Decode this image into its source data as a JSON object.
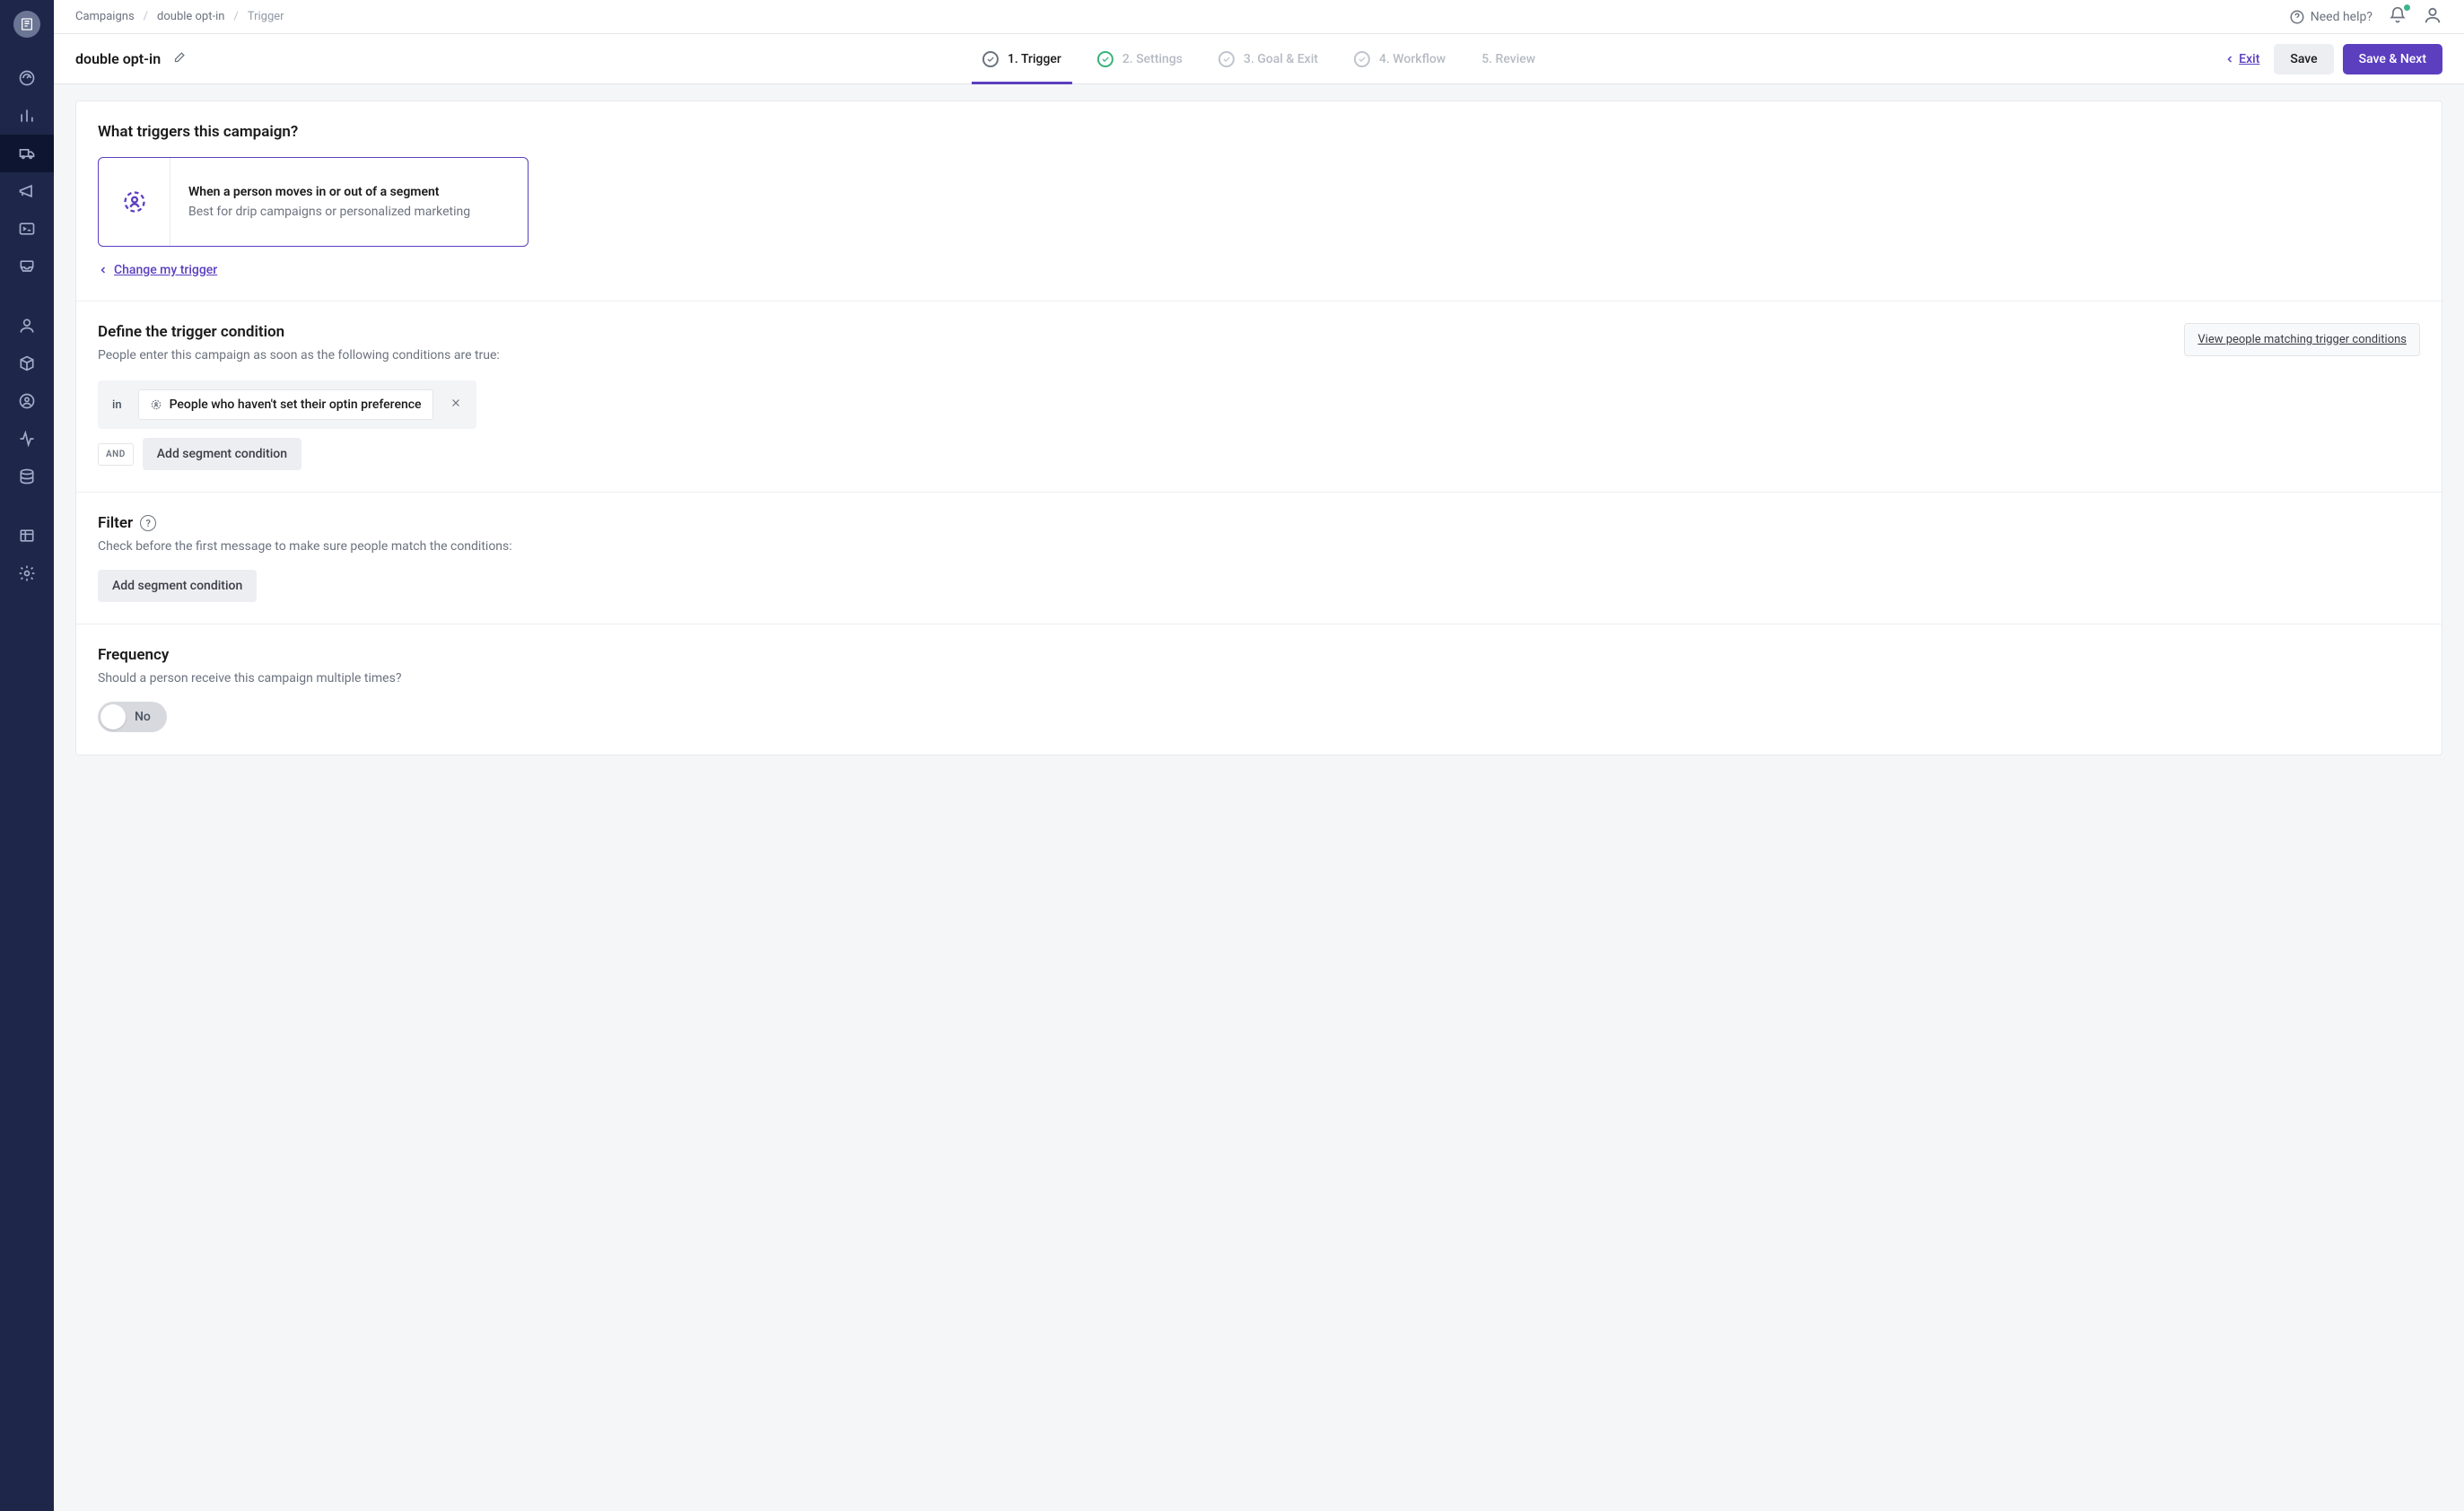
{
  "sidebar": {
    "items": [
      {
        "name": "logo"
      },
      {
        "name": "dashboard-icon"
      },
      {
        "name": "chart-icon"
      },
      {
        "name": "delivery-icon",
        "active": true
      },
      {
        "name": "megaphone-icon"
      },
      {
        "name": "terminal-icon"
      },
      {
        "name": "inbox-icon"
      },
      {
        "name": "gap"
      },
      {
        "name": "user-icon"
      },
      {
        "name": "cube-icon"
      },
      {
        "name": "target-user-icon"
      },
      {
        "name": "activity-icon"
      },
      {
        "name": "database-icon"
      },
      {
        "name": "gap"
      },
      {
        "name": "table-icon"
      },
      {
        "name": "gear-icon"
      }
    ]
  },
  "breadcrumb": {
    "root": "Campaigns",
    "parent": "double opt-in",
    "current": "Trigger"
  },
  "topright": {
    "help": "Need help?"
  },
  "header": {
    "title": "double opt-in"
  },
  "steps": {
    "s1": "1. Trigger",
    "s2": "2. Settings",
    "s3": "3. Goal & Exit",
    "s4": "4. Workflow",
    "s5": "5. Review"
  },
  "actions": {
    "exit": "Exit",
    "save": "Save",
    "save_next": "Save & Next"
  },
  "trigger_section": {
    "heading": "What triggers this campaign?",
    "box_title": "When a person moves in or out of a segment",
    "box_sub": "Best for drip campaigns or personalized marketing",
    "change_link": "Change my trigger"
  },
  "condition_section": {
    "heading": "Define the trigger condition",
    "sub": "People enter this campaign as soon as the following conditions are true:",
    "view_link": "View people matching trigger conditions",
    "prefix": "in",
    "segment_name": "People who haven't set their optin preference",
    "and_label": "AND",
    "add_btn": "Add segment condition"
  },
  "filter_section": {
    "heading": "Filter",
    "sub": "Check before the first message to make sure people match the conditions:",
    "add_btn": "Add segment condition"
  },
  "frequency_section": {
    "heading": "Frequency",
    "sub": "Should a person receive this campaign multiple times?",
    "toggle_label": "No"
  },
  "colors": {
    "accent": "#5b3fbf",
    "sidebar_bg": "#1e2749",
    "success": "#38b27a"
  }
}
